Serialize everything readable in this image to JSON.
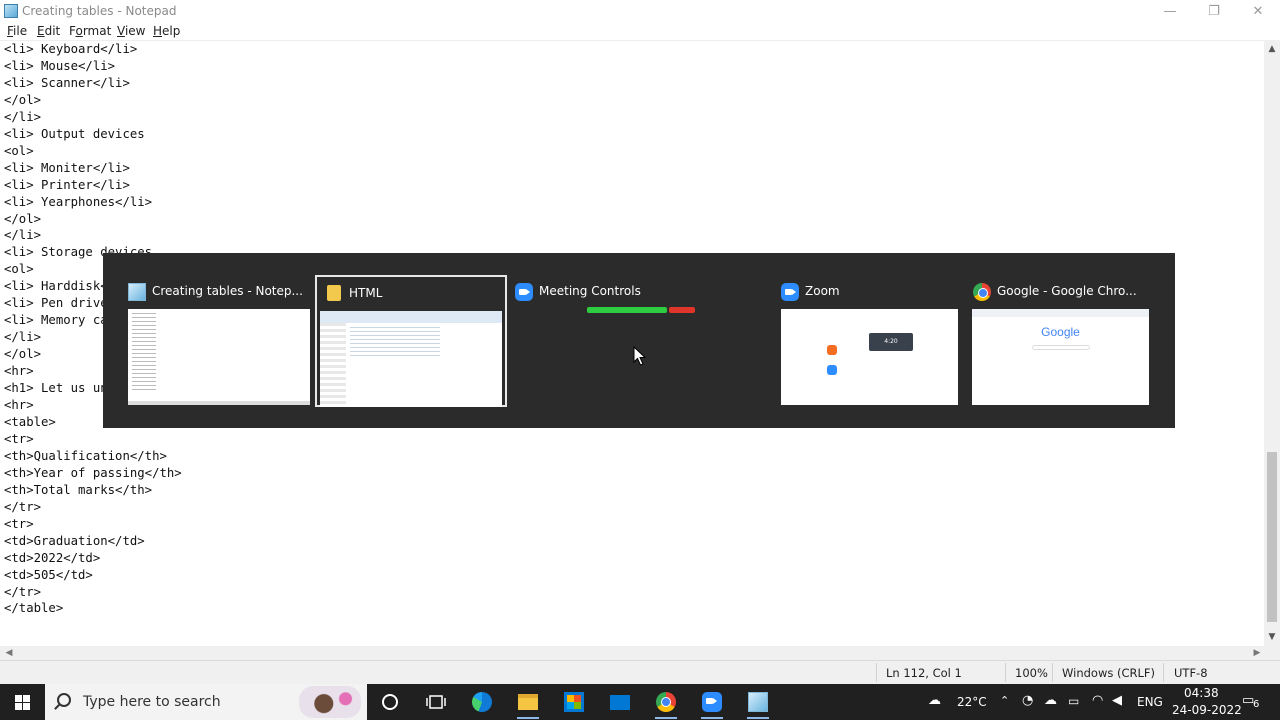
{
  "window": {
    "title": "Creating tables - Notepad",
    "controls": {
      "minimize": "—",
      "restore": "❐",
      "close": "✕"
    }
  },
  "menu": [
    {
      "label": "File",
      "mnemonic": "F",
      "rest": "ile"
    },
    {
      "label": "Edit",
      "mnemonic": "E",
      "rest": "dit"
    },
    {
      "label": "Format",
      "mnemonic": "o",
      "pre": "F",
      "rest": "rmat"
    },
    {
      "label": "View",
      "mnemonic": "V",
      "rest": "iew"
    },
    {
      "label": "Help",
      "mnemonic": "H",
      "rest": "elp"
    }
  ],
  "editor": {
    "lines": [
      "<li> Keyboard</li>",
      "<li> Mouse</li>",
      "<li> Scanner</li>",
      "</ol>",
      "</li>",
      "<li> Output devices",
      "<ol>",
      "<li> Moniter</li>",
      "<li> Printer</li>",
      "<li> Yearphones</li>",
      "</ol>",
      "</li>",
      "<li> Storage devices",
      "<ol>",
      "<li> Harddisk</li>",
      "<li> Pen drives</li>",
      "<li> Memory card</li>",
      "</li>",
      "</ol>",
      "<hr>",
      "<h1> Let us under",
      "<hr>",
      "<table>",
      "<tr>",
      "<th>Qualification</th>",
      "<th>Year of passing</th>",
      "<th>Total marks</th>",
      "</tr>",
      "<tr>",
      "<td>Graduation</td>",
      "<td>2022</td>",
      "<td>505</td>",
      "</tr>",
      "</table>"
    ]
  },
  "statusbar": {
    "position": "Ln 112, Col 1",
    "zoom": "100%",
    "line_ending": "Windows (CRLF)",
    "encoding": "UTF-8"
  },
  "switcher": {
    "items": [
      {
        "label": "Creating tables - Notep...",
        "icon": "notepad-icon"
      },
      {
        "label": "HTML",
        "icon": "folder-icon",
        "selected": true
      },
      {
        "label": "Meeting Controls",
        "icon": "zoom-icon"
      },
      {
        "label": "Zoom",
        "icon": "zoom-icon"
      },
      {
        "label": "Google - Google Chro...",
        "icon": "chrome-icon"
      }
    ],
    "thumb_text": {
      "google_logo": "Google",
      "zoom_time": "4:20"
    }
  },
  "taskbar": {
    "search_placeholder": "Type here to search",
    "apps": [
      "cortana-icon",
      "task-view-icon",
      "edge-icon",
      "file-explorer-icon",
      "store-icon",
      "mail-icon",
      "chrome-icon",
      "zoom-icon",
      "notepad-icon"
    ],
    "temperature": "22°C",
    "language": "ENG",
    "time": "04:38",
    "date": "24-09-2022",
    "notification_count": "6"
  },
  "colors": {
    "switcher_bg": "#2b2b2b",
    "taskbar_bg": "#202020",
    "zoom_blue": "#2d8cff",
    "meeting_green": "#2ecc40",
    "meeting_red": "#e0352b"
  }
}
